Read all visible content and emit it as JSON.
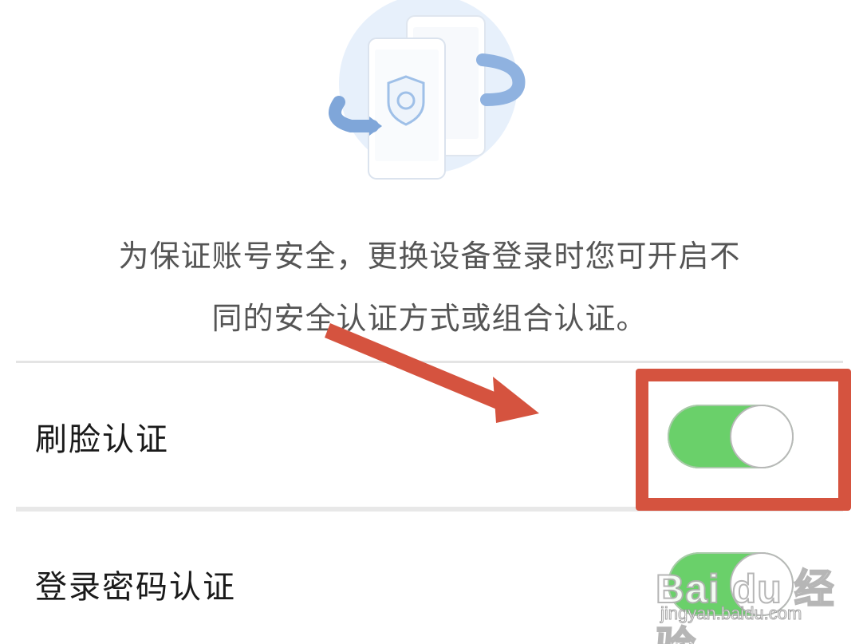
{
  "illustration": {
    "icon": "device-switch-shield-icon",
    "colors": {
      "circle": "#e7f0fb",
      "phone": "#ffffff",
      "arrow": "#7fa6d9",
      "shield": "#a9c6ea"
    }
  },
  "description": {
    "line1": "为保证账号安全，更换设备登录时您可开启不",
    "line2": "同的安全认证方式或组合认证。"
  },
  "settings": [
    {
      "label": "刷脸认证",
      "enabled": true
    },
    {
      "label": "登录密码认证",
      "enabled": true
    }
  ],
  "annotation": {
    "color": "#d5533f"
  },
  "watermark": {
    "logo": "Bai du 经验",
    "url": "jingyan.baidu.com"
  },
  "colors": {
    "toggle_on": "#6ad06a",
    "text_primary": "#1a1a1a",
    "text_secondary": "#555555",
    "divider": "#e4e4e4"
  }
}
